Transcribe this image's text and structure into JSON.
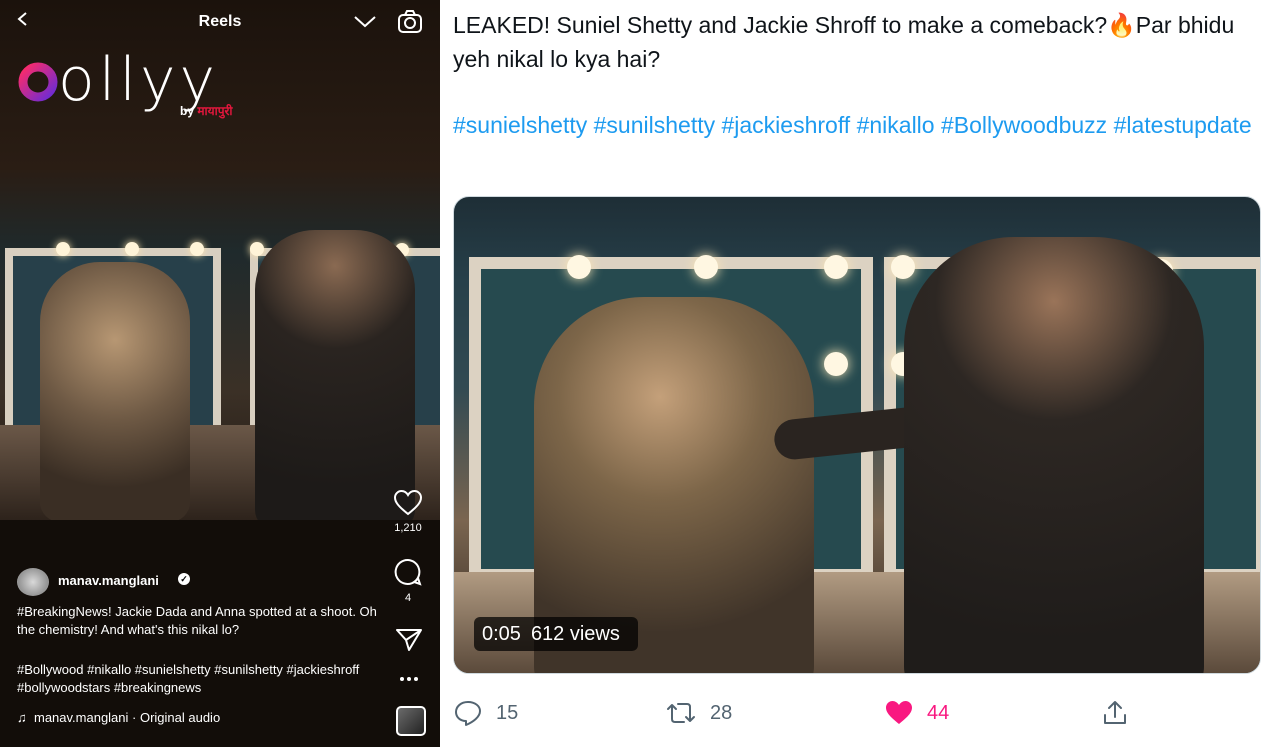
{
  "reel": {
    "header_title": "Reels",
    "logo": {
      "wordmark": "bollyy",
      "byline_prefix": "by",
      "byline_brand": "मायापुरी",
      "brand_color": "#e3173d"
    },
    "likes": "1,210",
    "comments": "4",
    "username": "manav.manglani",
    "caption": "#BreakingNews! Jackie Dada and Anna spotted at a shoot. Oh the chemistry! And what's this nikal lo?",
    "tags": "#Bollywood #nikallo #sunielshetty #sunilshetty #jackieshroff #bollywoodstars #breakingnews",
    "audio": "manav.manglani · Original audio"
  },
  "tweet": {
    "text": "LEAKED! Suniel Shetty and Jackie Shroff to make a comeback?🔥Par bhidu yeh nikal lo kya hai?",
    "hashtags": "#sunielshetty #sunilshetty #jackieshroff #nikallo #Bollywoodbuzz #latestupdate",
    "video_time": "0:05",
    "video_views": "612 views",
    "replies": "15",
    "retweets": "28",
    "likes": "44",
    "colors": {
      "link": "#1d9bf0",
      "like": "#f91880",
      "muted": "#536471"
    }
  }
}
